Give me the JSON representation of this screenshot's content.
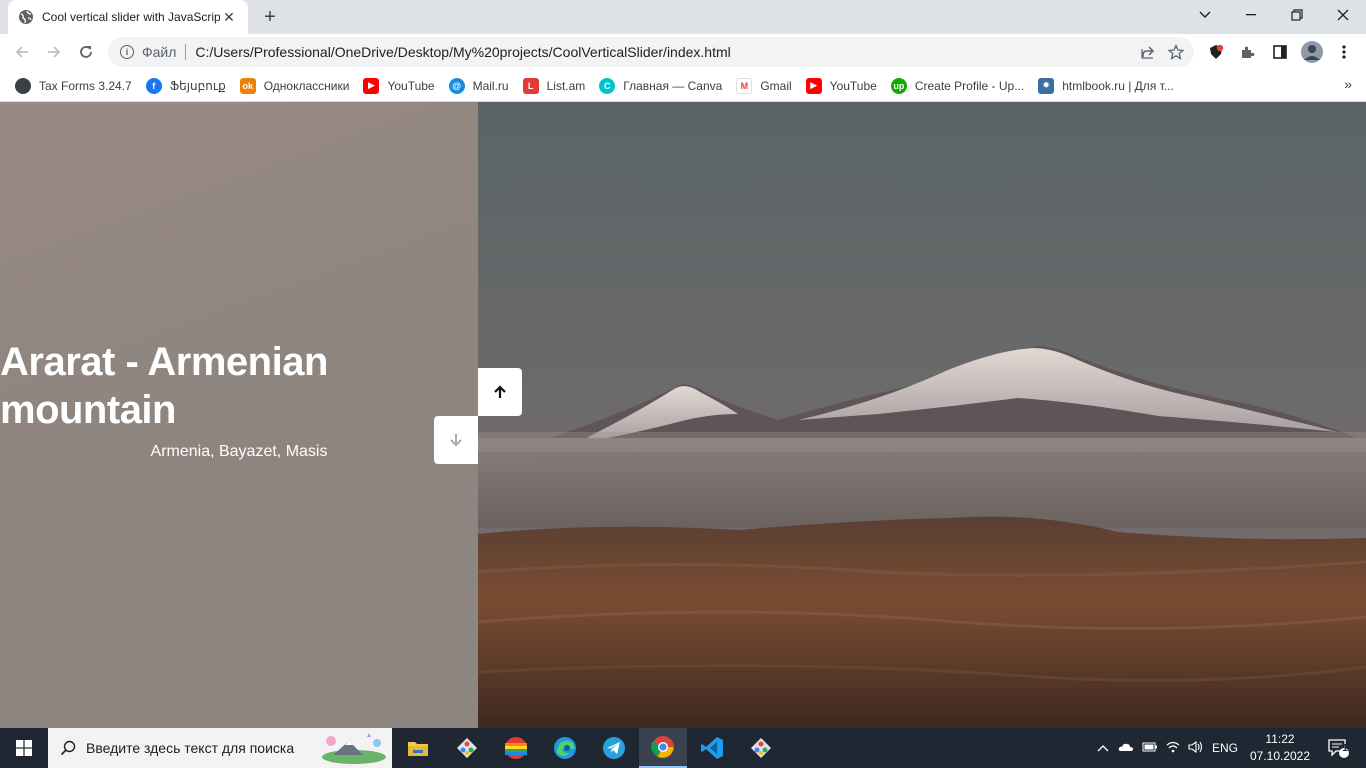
{
  "browser": {
    "tab_title": "Cool vertical slider with JavaScript",
    "omnibox_chip": "Файл",
    "url": "C:/Users/Professional/OneDrive/Desktop/My%20projects/CoolVerticalSlider/index.html"
  },
  "bookmarks": [
    {
      "label": "Tax Forms 3.24.7",
      "icon": "globe-icon",
      "color": "#3c4043"
    },
    {
      "label": "Ֆեյսբուք",
      "icon": "facebook-icon",
      "color": "#1877f2"
    },
    {
      "label": "Одноклассники",
      "icon": "odnoklassniki-icon",
      "color": "#ee8208"
    },
    {
      "label": "YouTube",
      "icon": "youtube-icon",
      "color": "#ff0000"
    },
    {
      "label": "Mail.ru",
      "icon": "mailru-icon",
      "color": "#168de2"
    },
    {
      "label": "List.am",
      "icon": "listam-icon",
      "color": "#e53935"
    },
    {
      "label": "Главная — Canva",
      "icon": "canva-icon",
      "color": "#00c4cc"
    },
    {
      "label": "Gmail",
      "icon": "gmail-icon",
      "color": "#ea4335"
    },
    {
      "label": "YouTube",
      "icon": "youtube-icon",
      "color": "#ff0000"
    },
    {
      "label": "Create Profile - Up...",
      "icon": "upwork-icon",
      "color": "#14a800"
    },
    {
      "label": "htmlbook.ru | Для т...",
      "icon": "htmlbook-icon",
      "color": "#3b6ea5"
    }
  ],
  "slide": {
    "title": "Ararat - Armenian mountain",
    "subtitle": "Armenia, Bayazet, Masis"
  },
  "taskbar": {
    "search_placeholder": "Введите здесь текст для поиска",
    "language": "ENG",
    "time": "11:22",
    "date": "07.10.2022",
    "notifications": "1"
  }
}
